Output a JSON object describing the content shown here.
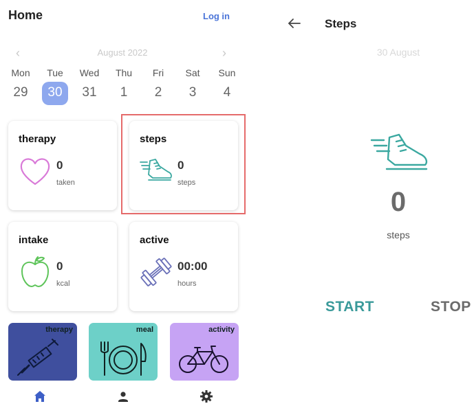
{
  "home": {
    "title": "Home",
    "login_label": "Log in",
    "calendar": {
      "month_label": "August 2022",
      "days": [
        {
          "name": "Mon",
          "date": "29"
        },
        {
          "name": "Tue",
          "date": "30",
          "selected": true
        },
        {
          "name": "Wed",
          "date": "31"
        },
        {
          "name": "Thu",
          "date": "1"
        },
        {
          "name": "Fri",
          "date": "2"
        },
        {
          "name": "Sat",
          "date": "3"
        },
        {
          "name": "Sun",
          "date": "4"
        }
      ]
    },
    "cards": {
      "therapy": {
        "title": "therapy",
        "value": "0",
        "unit": "taken",
        "icon": "heart-icon"
      },
      "steps": {
        "title": "steps",
        "value": "0",
        "unit": "steps",
        "icon": "shoe-icon"
      },
      "intake": {
        "title": "intake",
        "value": "0",
        "unit": "kcal",
        "icon": "apple-icon"
      },
      "active": {
        "title": "active",
        "value": "00:00",
        "unit": "hours",
        "icon": "dumbbell-icon"
      }
    },
    "tiles": {
      "therapy": {
        "label": "therapy",
        "color": "#3f4f9e",
        "icon": "syringe-icon"
      },
      "meal": {
        "label": "meal",
        "color": "#6dd0c8",
        "icon": "plate-cutlery-icon"
      },
      "activity": {
        "label": "activity",
        "color": "#c6a3f4",
        "icon": "bicycle-icon"
      }
    },
    "nav": [
      "home-icon",
      "profile-icon",
      "settings-icon"
    ]
  },
  "steps_screen": {
    "title": "Steps",
    "date_label": "30 August",
    "count": "0",
    "unit": "steps",
    "start_label": "START",
    "stop_label": "STOP"
  },
  "colors": {
    "accent_blue": "#4a74d8",
    "selected_day": "#8ea8ee",
    "teal": "#3a9a9a",
    "highlight": "#e56a6a"
  }
}
